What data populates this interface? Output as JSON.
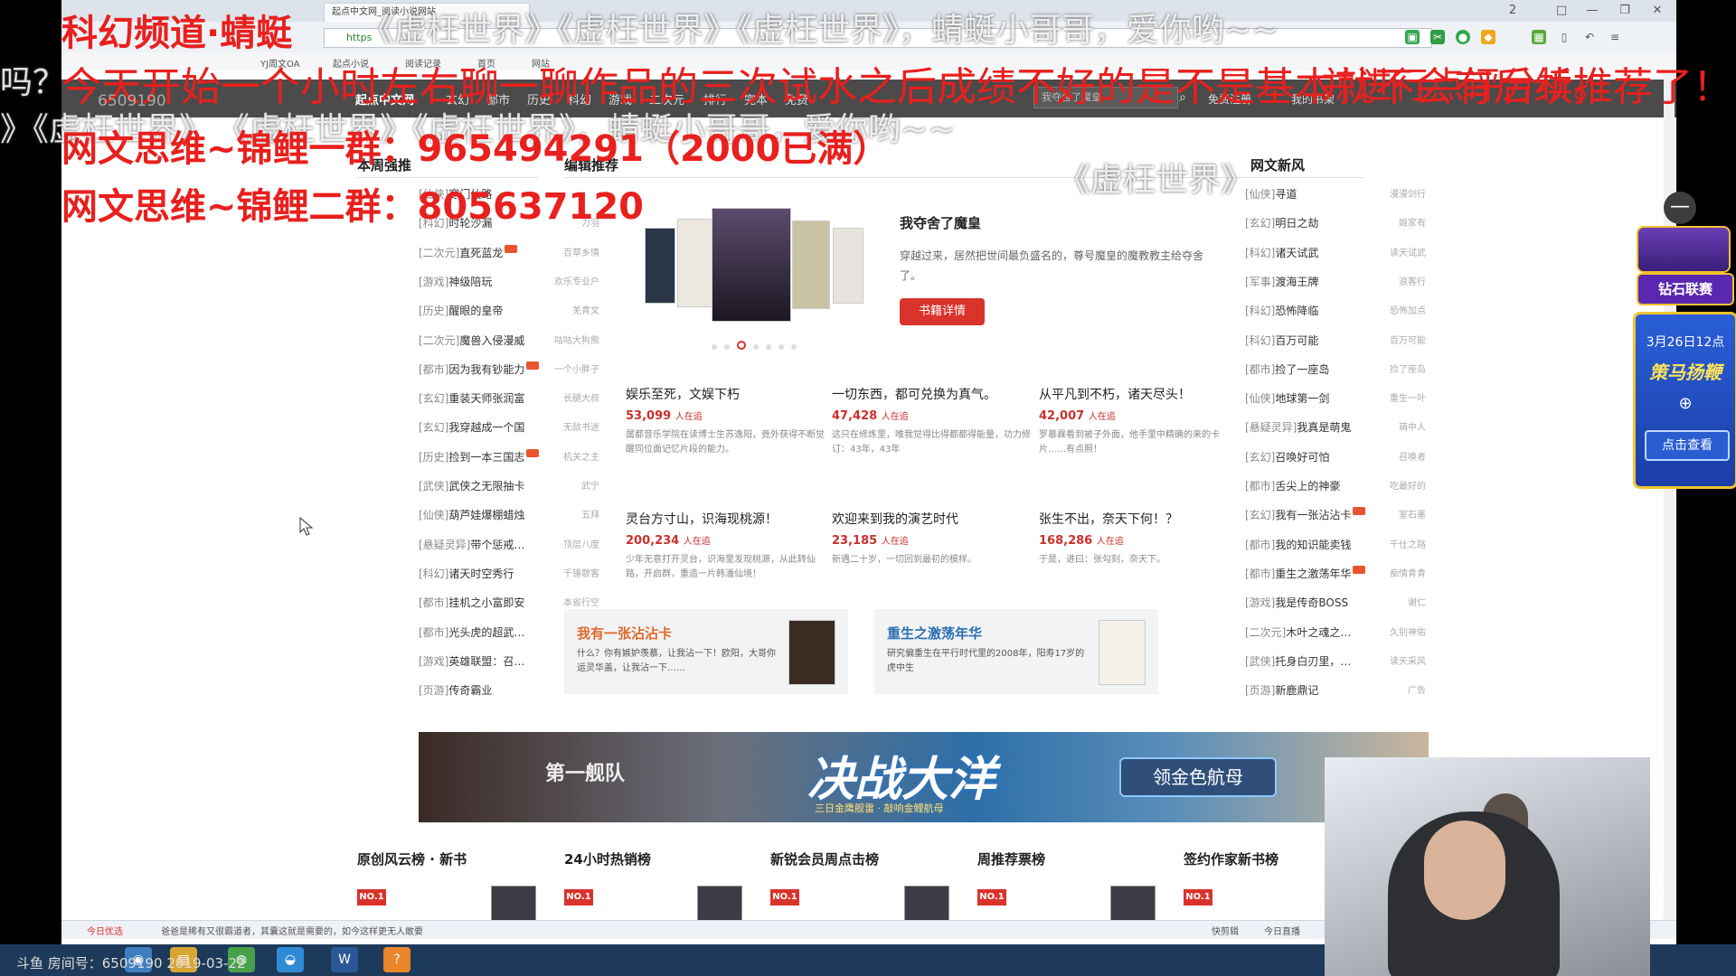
{
  "browser": {
    "tabs": [
      "起点中文网_阅读小说网站",
      "YJ周文OA"
    ],
    "address": "https",
    "bookmarks": [
      "YJ周文OA",
      "起点小说",
      "阅读记录",
      "首页",
      "网站"
    ],
    "window_controls": [
      "2",
      "□",
      "—",
      "❐",
      "✕"
    ]
  },
  "site": {
    "logo": "起点中文网",
    "nav": [
      "玄幻",
      "都市",
      "历史",
      "科幻",
      "游戏",
      "二次元",
      "排行",
      "完本",
      "免费"
    ],
    "search_placeholder": "我夺舍了魔皇",
    "header_links": [
      "免费注册",
      "我的书架"
    ]
  },
  "weekly": {
    "title": "本周强推",
    "items": [
      {
        "cat": "[仙侠]",
        "name": "寒门仙路",
        "author": "",
        "new": false
      },
      {
        "cat": "[科幻]",
        "name": "时轮沙漏",
        "author": "力羽",
        "new": false
      },
      {
        "cat": "[二次元]",
        "name": "直死蓝龙",
        "author": "百草乡情",
        "new": true
      },
      {
        "cat": "[游戏]",
        "name": "神级陪玩",
        "author": "欢乐专业户",
        "new": false
      },
      {
        "cat": "[历史]",
        "name": "醒眼的皇帝",
        "author": "羌青文",
        "new": false
      },
      {
        "cat": "[二次元]",
        "name": "魔兽入侵漫威",
        "author": "咕咕大狗熊",
        "new": false
      },
      {
        "cat": "[都市]",
        "name": "因为我有钞能力",
        "author": "一个小胖子",
        "new": true
      },
      {
        "cat": "[玄幻]",
        "name": "重装天师张润富",
        "author": "长腿大叔",
        "new": false
      },
      {
        "cat": "[玄幻]",
        "name": "我穿越成一个国",
        "author": "无敌书迷",
        "new": false
      },
      {
        "cat": "[历史]",
        "name": "捡到一本三国志",
        "author": "机关之主",
        "new": true
      },
      {
        "cat": "[武侠]",
        "name": "武侠之无限抽卡",
        "author": "武宁",
        "new": false
      },
      {
        "cat": "[仙侠]",
        "name": "葫芦娃爆棚蜡烛",
        "author": "五拜",
        "new": false
      },
      {
        "cat": "[悬疑灵异]",
        "name": "带个惩戒…",
        "author": "顶层八度",
        "new": false
      },
      {
        "cat": "[科幻]",
        "name": "诸天时空秀行",
        "author": "千锤散客",
        "new": false
      },
      {
        "cat": "[都市]",
        "name": "挂机之小富即安",
        "author": "本省行空",
        "new": false
      },
      {
        "cat": "[都市]",
        "name": "光头虎的超武…",
        "author": "自制的帽",
        "new": false
      },
      {
        "cat": "[游戏]",
        "name": "英雄联盟：召…",
        "author": "猫轮",
        "new": false
      },
      {
        "cat": "[页游]",
        "name": "传奇霸业",
        "author": "广告",
        "new": false
      }
    ]
  },
  "editor": {
    "title": "编辑推荐",
    "feature": {
      "title": "我夺舍了魔皇",
      "desc": "穿越过来，居然把世间最负盛名的，尊号魔皇的魔教教主给夺舍了。",
      "button": "书籍详情"
    },
    "books": [
      {
        "title": "娱乐至死，文娱下朽",
        "num": "53,099",
        "unit": "人在追",
        "desc": "属都音乐学院在读博士生苏逸阳，竟外获得不断觉醒同位面记忆片段的能力。"
      },
      {
        "title": "一切东西，都可兑换为真气。",
        "num": "47,428",
        "unit": "人在追",
        "desc": "这只在修炼里，唯我觉得比得都都得能量，功力修订：43年，43年"
      },
      {
        "title": "从平凡到不朽，诸天尽头！",
        "num": "42,007",
        "unit": "人在追",
        "desc": "罗慕霖看到被子外面，他手里中精确的来的卡片……有点照！"
      },
      {
        "title": "灵台方寸山，识海现桃源！",
        "num": "200,234",
        "unit": "人在追",
        "desc": "少年无意打开灵台，识海里发现桃源，从此转仙路，开启群，重造一片韩潘仙境！"
      },
      {
        "title": "欢迎来到我的演艺时代",
        "num": "23,185",
        "unit": "人在追",
        "desc": "新遇二十岁，一切回到最初的模样。"
      },
      {
        "title": "张生不出，奈天下何！？",
        "num": "168,286",
        "unit": "人在追",
        "desc": "于是，进曰：张勾刻，奈天下。"
      }
    ],
    "promos": [
      {
        "title": "我有一张沾沾卡",
        "desc": "什么？你有嫉妒羡慕，让我沾一下！欧阳，大哥你运灵华盖，让我沾一下……",
        "color": "#e06a2b"
      },
      {
        "title": "重生之激荡年华",
        "desc": "研究偏重生在平行时代里的2008年，阳寿17岁的虎中生",
        "color": "#2a6fb3"
      }
    ]
  },
  "news": {
    "title": "网文新风",
    "items": [
      {
        "cat": "[仙侠]",
        "name": "寻道",
        "author": "漫漫剑行",
        "new": false
      },
      {
        "cat": "[玄幻]",
        "name": "明日之劫",
        "author": "姬家有",
        "new": false
      },
      {
        "cat": "[科幻]",
        "name": "诸天试武",
        "author": "读天试武",
        "new": false
      },
      {
        "cat": "[军事]",
        "name": "渡海王牌",
        "author": "浪客行",
        "new": false
      },
      {
        "cat": "[科幻]",
        "name": "恐怖降临",
        "author": "恐怖加点",
        "new": false
      },
      {
        "cat": "[科幻]",
        "name": "百万可能",
        "author": "百万可能",
        "new": false
      },
      {
        "cat": "[都市]",
        "name": "捡了一座岛",
        "author": "捡了座岛",
        "new": false
      },
      {
        "cat": "[仙侠]",
        "name": "地球第一剑",
        "author": "重生一叶",
        "new": false
      },
      {
        "cat": "[悬疑灵异]",
        "name": "我真是萌鬼",
        "author": "萌中人",
        "new": false
      },
      {
        "cat": "[玄幻]",
        "name": "召唤好可怕",
        "author": "召唤者",
        "new": false
      },
      {
        "cat": "[都市]",
        "name": "舌尖上的神豪",
        "author": "吃最好的",
        "new": false
      },
      {
        "cat": "[玄幻]",
        "name": "我有一张沾沾卡",
        "author": "室石墨",
        "new": true
      },
      {
        "cat": "[都市]",
        "name": "我的知识能卖钱",
        "author": "千仕之路",
        "new": false
      },
      {
        "cat": "[都市]",
        "name": "重生之激荡年华",
        "author": "痴情青青",
        "new": true
      },
      {
        "cat": "[游戏]",
        "name": "我是传奇BOSS",
        "author": "谢仁",
        "new": false
      },
      {
        "cat": "[二次元]",
        "name": "木叶之魂之…",
        "author": "久别神佑",
        "new": false
      },
      {
        "cat": "[武侠]",
        "name": "托身白刃里，…",
        "author": "读天采风",
        "new": false
      },
      {
        "cat": "[页游]",
        "name": "新鹿鼎记",
        "author": "广告",
        "new": false
      }
    ]
  },
  "banner": {
    "t1": "第一舰队",
    "t2": "决战大洋",
    "t3": "三日金鹰舰雷 · 敲响金鲤航母",
    "button": "领金色航母"
  },
  "ranks": [
    {
      "title": "原创风云榜 · 新书",
      "no": "NO.1"
    },
    {
      "title": "24小时热销榜",
      "no": "NO.1"
    },
    {
      "title": "新锐会员周点击榜",
      "no": "NO.1"
    },
    {
      "title": "周推荐票榜",
      "no": "NO.1"
    },
    {
      "title": "签约作家新书榜",
      "no": "NO.1"
    }
  ],
  "statusbar": {
    "left": "今日优选",
    "center": "爸爸是稀有又很霸道者，其囊这就是需要的，如今这样更无人敢要",
    "right1": "快剪辑",
    "right2": "今日直播"
  },
  "taskbar": {
    "room": "斗鱼 房间号：6509190",
    "date": "2019-03-22"
  },
  "overlay": {
    "line1": "科幻频道·蜻蜓",
    "scroll1": "《虚枉世界》《虚枉世界》《虚枉世界》，蜻蜓小哥哥，爱你哟~~",
    "line2": "今天开始一个小时左右聊一聊作品的三次试水之后成绩不好的是不是基本就不会有后续推荐了！",
    "line2_tail": "吗？",
    "scroll2": "《虚枉世界》《虚枉世界》，蜻蜓小哥哥，爱你哟~~",
    "scroll3": "》《虚枉世界》",
    "group1": "网文思维~锦鲤一群：965494291（2000已满）",
    "group2": "网文思维~锦鲤二群：805637120",
    "scroll4": "《虚枉世界》",
    "roomtag": "房间号",
    "roomnum": "6509190",
    "mid_red": "三次试水之后成绩不好的是不是基本就不会有后续推荐了!",
    "right_red": "并进行点评分析。"
  },
  "side_widget": {
    "brand": "钻石联赛",
    "date": "3月26日12点",
    "event": "策马扬鞭",
    "button": "点击查看",
    "toggle": "—"
  }
}
